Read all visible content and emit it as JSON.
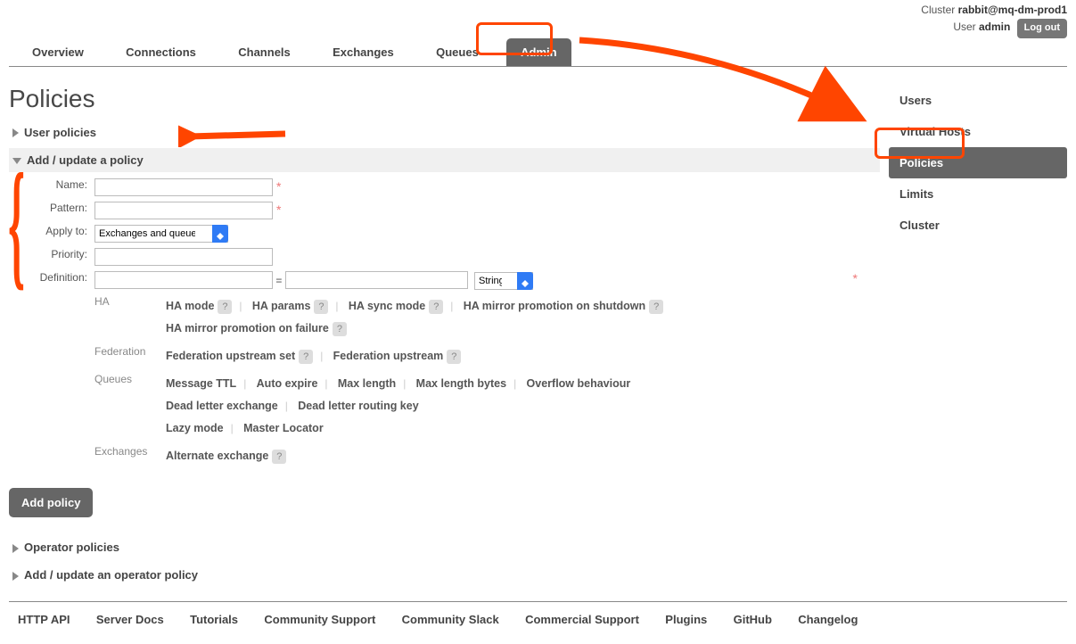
{
  "status": {
    "cluster_prefix": "Cluster ",
    "cluster_name": "rabbit@mq-dm-prod1",
    "user_prefix": "User ",
    "user_name": "admin",
    "logout": "Log out"
  },
  "tabs": {
    "overview": "Overview",
    "connections": "Connections",
    "channels": "Channels",
    "exchanges": "Exchanges",
    "queues": "Queues",
    "admin": "Admin"
  },
  "page": {
    "title": "Policies"
  },
  "sections": {
    "user_policies": "User policies",
    "add_update": "Add / update a policy",
    "operator_policies": "Operator policies",
    "add_update_operator": "Add / update an operator policy"
  },
  "sidebar": {
    "users": "Users",
    "vhosts": "Virtual Hosts",
    "policies": "Policies",
    "limits": "Limits",
    "cluster": "Cluster"
  },
  "form": {
    "labels": {
      "name": "Name:",
      "pattern": "Pattern:",
      "apply_to": "Apply to:",
      "priority": "Priority:",
      "definition": "Definition:"
    },
    "apply_to_value": "Exchanges and queues",
    "def_type_value": "String",
    "submit": "Add policy"
  },
  "definition_groups": {
    "ha": {
      "label": "HA",
      "ha_mode": "HA mode",
      "ha_params": "HA params",
      "ha_sync_mode": "HA sync mode",
      "ha_mirror_shutdown": "HA mirror promotion on shutdown",
      "ha_mirror_failure": "HA mirror promotion on failure"
    },
    "federation": {
      "label": "Federation",
      "upstream_set": "Federation upstream set",
      "upstream": "Federation upstream"
    },
    "queues": {
      "label": "Queues",
      "message_ttl": "Message TTL",
      "auto_expire": "Auto expire",
      "max_length": "Max length",
      "max_length_bytes": "Max length bytes",
      "overflow": "Overflow behaviour",
      "dlx": "Dead letter exchange",
      "dlrk": "Dead letter routing key",
      "lazy": "Lazy mode",
      "master_locator": "Master Locator"
    },
    "exchanges": {
      "label": "Exchanges",
      "ae": "Alternate exchange"
    }
  },
  "footer": {
    "http_api": "HTTP API",
    "server_docs": "Server Docs",
    "tutorials": "Tutorials",
    "community_support": "Community Support",
    "community_slack": "Community Slack",
    "commercial_support": "Commercial Support",
    "plugins": "Plugins",
    "github": "GitHub",
    "changelog": "Changelog"
  }
}
